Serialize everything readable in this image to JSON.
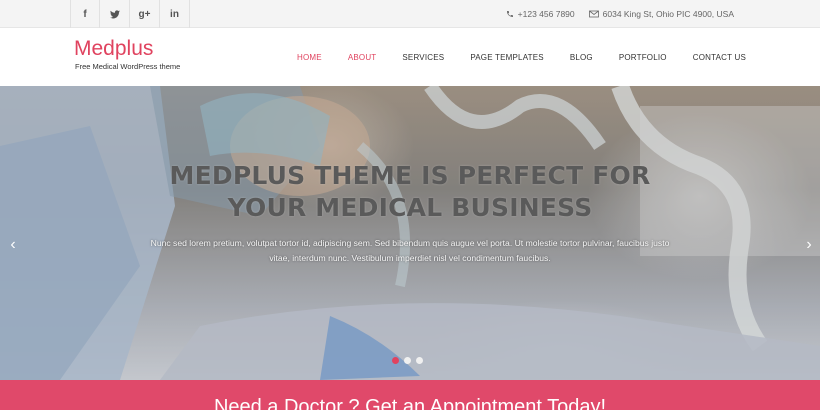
{
  "topbar": {
    "social": [
      {
        "icon": "facebook-icon",
        "glyph": "f"
      },
      {
        "icon": "twitter-icon",
        "glyph": "t"
      },
      {
        "icon": "google-plus-icon",
        "glyph": "g+"
      },
      {
        "icon": "linkedin-icon",
        "glyph": "in"
      }
    ],
    "phone": "+123 456 7890",
    "address": "6034 King St, Ohio PIC 4900, USA"
  },
  "header": {
    "logo_title": "Medplus",
    "logo_tagline": "Free Medical WordPress theme",
    "nav": [
      "HOME",
      "ABOUT",
      "SERVICES",
      "PAGE TEMPLATES",
      "BLOG",
      "PORTFOLIO",
      "CONTACT US"
    ],
    "active_nav": "HOME"
  },
  "hero": {
    "title_line1": "MEDPLUS THEME IS PERFECT FOR",
    "title_line2": "YOUR MEDICAL BUSINESS",
    "text": "Nunc sed lorem pretium, volutpat tortor id, adipiscing sem. Sed bibendum quis augue vel porta. Ut molestie tortor pulvinar, faucibus justo vitae, interdum nunc. Vestibulum imperdiet nisl vel condimentum faucibus.",
    "prev_arrow": "‹",
    "next_arrow": "›",
    "slides_total": 3,
    "slide_active": 1
  },
  "banner": {
    "text": "Need a Doctor ? Get an Appointment Today!"
  },
  "colors": {
    "accent": "#e0435f",
    "banner": "#e0496a"
  }
}
